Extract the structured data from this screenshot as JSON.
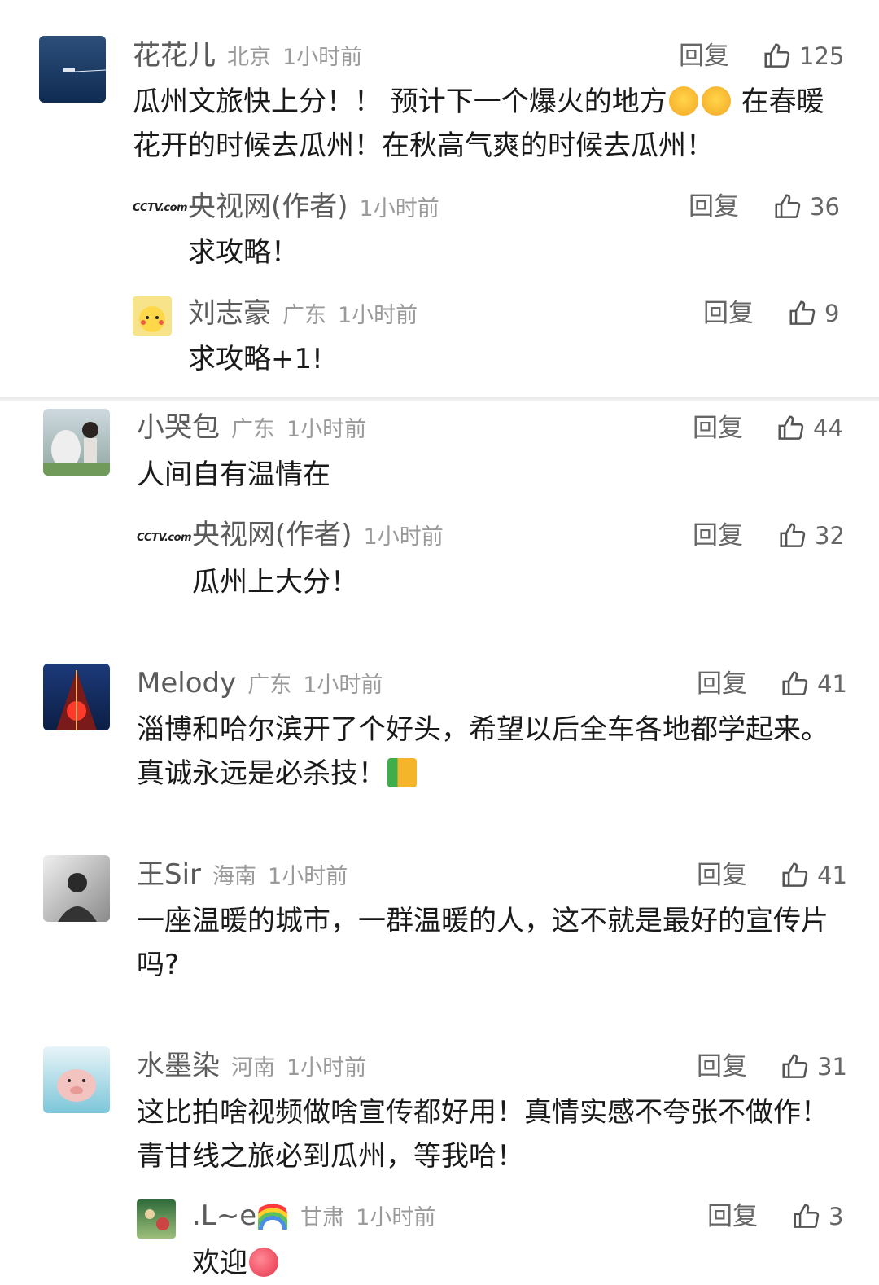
{
  "reply_label": "回复",
  "comments": [
    {
      "name": "花花儿",
      "loc": "北京",
      "time": "1小时前",
      "likes": "125",
      "text": "瓜州文旅快上分！！ 预计下一个爆火的地方",
      "text2": "在春暖花开的时候去瓜州！在秋高气爽的时候去瓜州！",
      "replies": [
        {
          "name": "央视网(作者)",
          "loc": "",
          "time": "1小时前",
          "likes": "36",
          "text": "求攻略！"
        },
        {
          "name": "刘志豪",
          "loc": "广东",
          "time": "1小时前",
          "likes": "9",
          "text": "求攻略+1!"
        }
      ]
    },
    {
      "name": "小哭包",
      "loc": "广东",
      "time": "1小时前",
      "likes": "44",
      "text": "人间自有温情在",
      "replies": [
        {
          "name": "央视网(作者)",
          "loc": "",
          "time": "1小时前",
          "likes": "32",
          "text": "瓜州上大分！"
        }
      ]
    },
    {
      "name": "Melody",
      "loc": "广东",
      "time": "1小时前",
      "likes": "41",
      "text": "淄博和哈尔滨开了个好头，希望以后全车各地都学起来。真诚永远是必杀技！"
    },
    {
      "name": "王Sir",
      "loc": "海南",
      "time": "1小时前",
      "likes": "41",
      "text": "一座温暖的城市，一群温暖的人，这不就是最好的宣传片吗?"
    },
    {
      "name": "水墨染",
      "loc": "河南",
      "time": "1小时前",
      "likes": "31",
      "text": "这比拍啥视频做啥宣传都好用！真情实感不夸张不做作！青甘线之旅必到瓜州，等我哈！",
      "replies": [
        {
          "name": ".L~e",
          "loc": "甘肃",
          "time": "1小时前",
          "likes": "3",
          "text": "欢迎"
        }
      ]
    }
  ],
  "cctv_logo_text": "CCTV.com",
  "icons": {
    "like": "thumbs-up-icon",
    "emoji_heart_eyes": "heart-eyes-emoji",
    "emoji_thumb": "thumbs-up-emoji",
    "emoji_rainbow": "rainbow-emoji",
    "emoji_heart": "heart-emoji"
  }
}
